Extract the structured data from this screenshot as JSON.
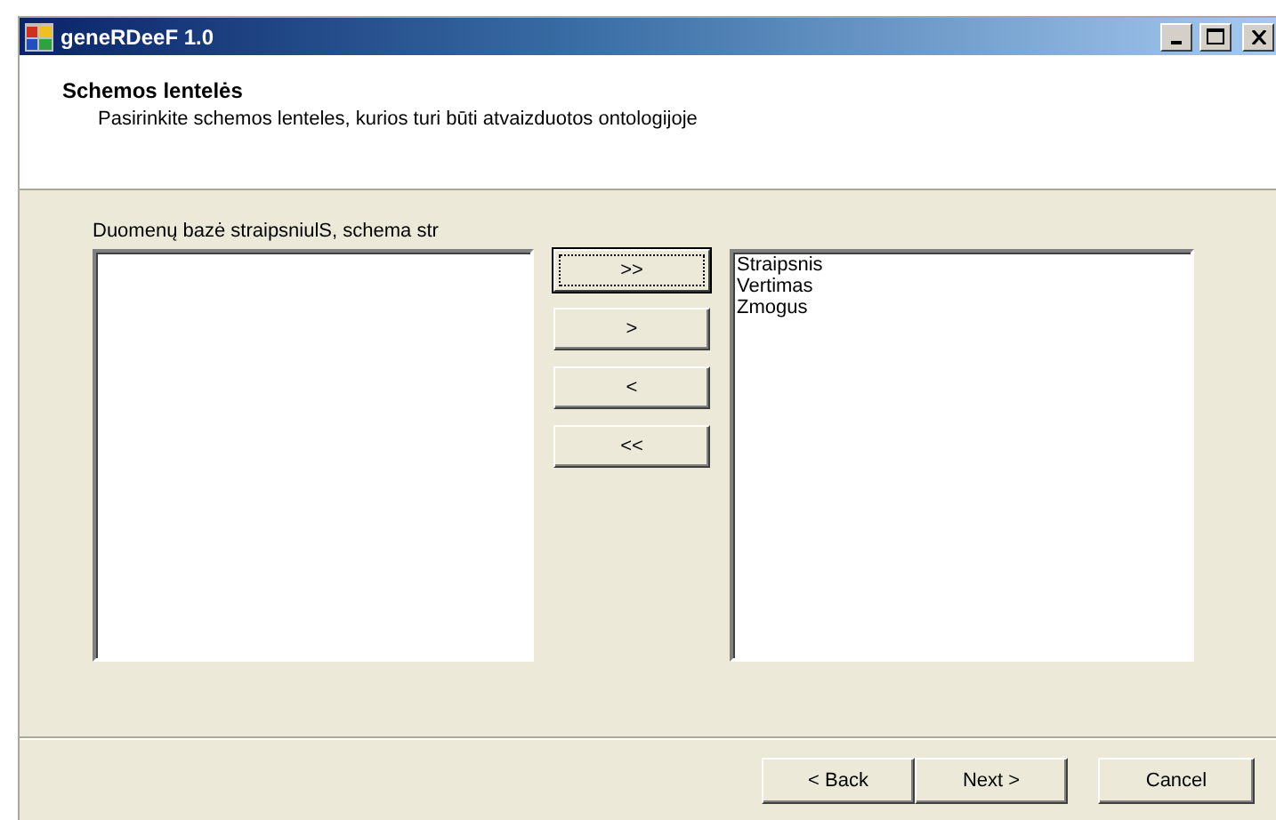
{
  "window": {
    "title": "geneRDeeF 1.0"
  },
  "header": {
    "title": "Schemos lentelės",
    "subtitle": "Pasirinkite schemos lenteles, kurios turi būti atvaizduotos ontologijoje"
  },
  "source_label": "Duomenų bazė straipsniulS, schema str",
  "move_buttons": [
    {
      "label": ">>",
      "focused": true
    },
    {
      "label": ">",
      "focused": false
    },
    {
      "label": "<",
      "focused": false
    },
    {
      "label": "<<",
      "focused": false
    }
  ],
  "right_list": {
    "items": [
      "Straipsnis",
      "Vertimas",
      "Zmogus"
    ]
  },
  "footer_buttons": [
    {
      "label": "< Back"
    },
    {
      "label": "Next >"
    },
    {
      "label": "Cancel"
    }
  ]
}
